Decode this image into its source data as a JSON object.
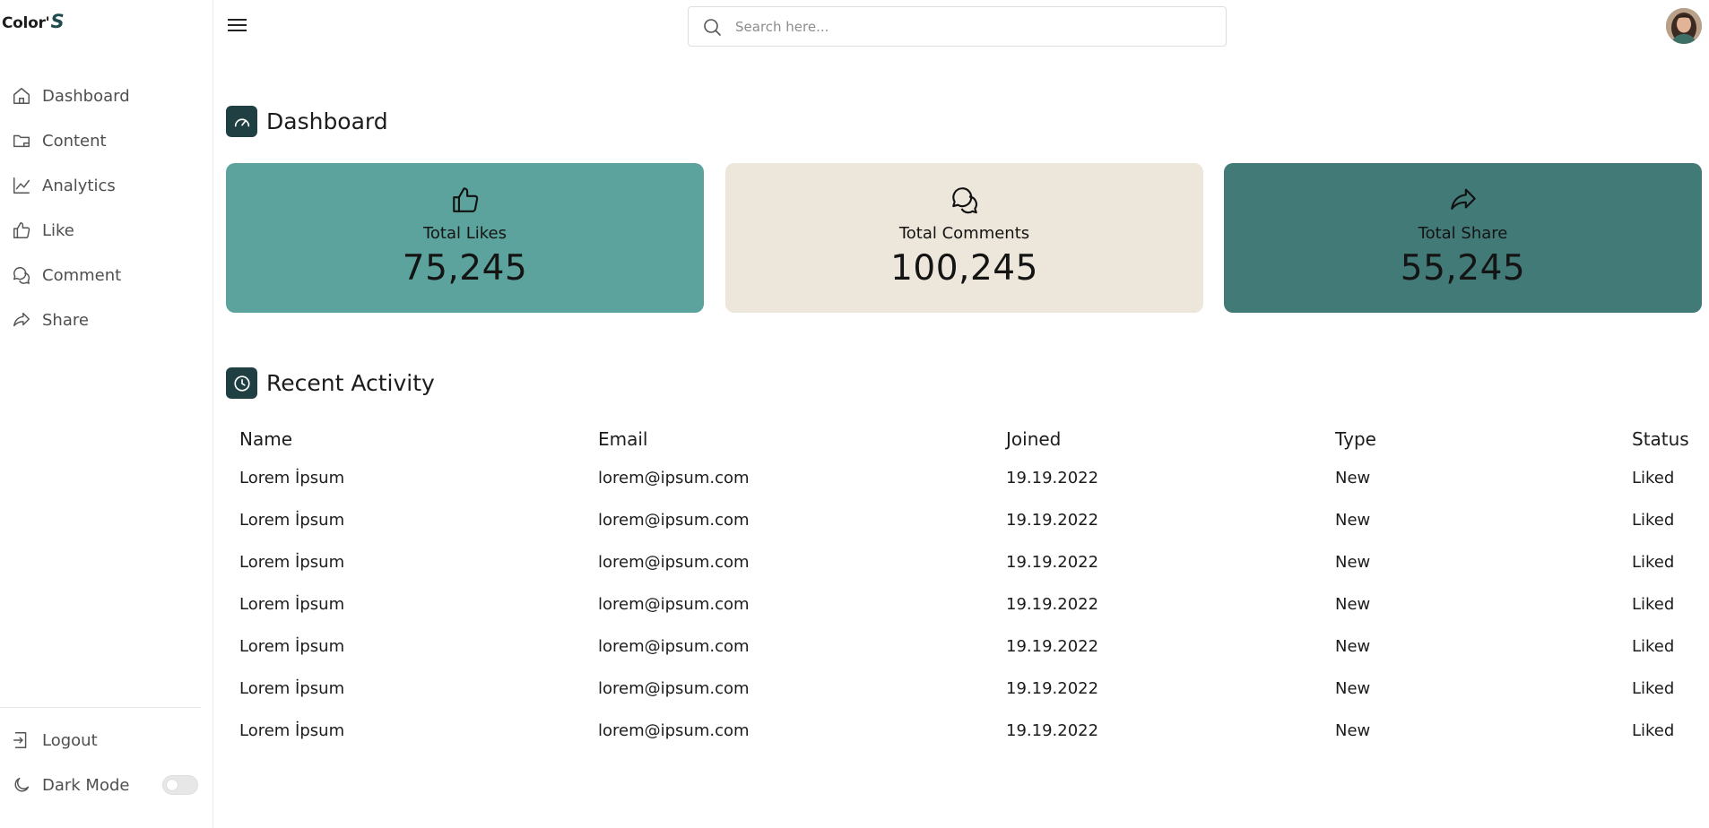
{
  "app": {
    "logo_text": "Color'",
    "logo_mark": "S"
  },
  "sidebar": {
    "items": [
      {
        "label": "Dashboard",
        "icon": "home-icon"
      },
      {
        "label": "Content",
        "icon": "folder-icon"
      },
      {
        "label": "Analytics",
        "icon": "line-chart-icon"
      },
      {
        "label": "Like",
        "icon": "thumbs-up-icon"
      },
      {
        "label": "Comment",
        "icon": "comments-icon"
      },
      {
        "label": "Share",
        "icon": "share-icon"
      }
    ],
    "bottom": [
      {
        "label": "Logout",
        "icon": "logout-icon"
      },
      {
        "label": "Dark Mode",
        "icon": "moon-icon"
      }
    ],
    "dark_mode_on": false
  },
  "header": {
    "search_placeholder": "Search here..."
  },
  "dashboard": {
    "title": "Dashboard",
    "cards": [
      {
        "label": "Total Likes",
        "value": "75,245",
        "color": "#5ba39c",
        "icon": "thumbs-up-icon"
      },
      {
        "label": "Total Comments",
        "value": "100,245",
        "color": "#ede6da",
        "icon": "comments-icon"
      },
      {
        "label": "Total Share",
        "value": "55,245",
        "color": "#427a78",
        "icon": "share-icon"
      }
    ]
  },
  "activity": {
    "title": "Recent Activity",
    "columns": [
      "Name",
      "Email",
      "Joined",
      "Type",
      "Status"
    ],
    "rows": [
      [
        "Lorem İpsum",
        "lorem@ipsum.com",
        "19.19.2022",
        "New",
        "Liked"
      ],
      [
        "Lorem İpsum",
        "lorem@ipsum.com",
        "19.19.2022",
        "New",
        "Liked"
      ],
      [
        "Lorem İpsum",
        "lorem@ipsum.com",
        "19.19.2022",
        "New",
        "Liked"
      ],
      [
        "Lorem İpsum",
        "lorem@ipsum.com",
        "19.19.2022",
        "New",
        "Liked"
      ],
      [
        "Lorem İpsum",
        "lorem@ipsum.com",
        "19.19.2022",
        "New",
        "Liked"
      ],
      [
        "Lorem İpsum",
        "lorem@ipsum.com",
        "19.19.2022",
        "New",
        "Liked"
      ],
      [
        "Lorem İpsum",
        "lorem@ipsum.com",
        "19.19.2022",
        "New",
        "Liked"
      ]
    ]
  },
  "colors": {
    "accent_dark": "#1f3f42",
    "card_green": "#5ba39c",
    "card_beige": "#ede6da",
    "card_teal": "#427a78"
  }
}
